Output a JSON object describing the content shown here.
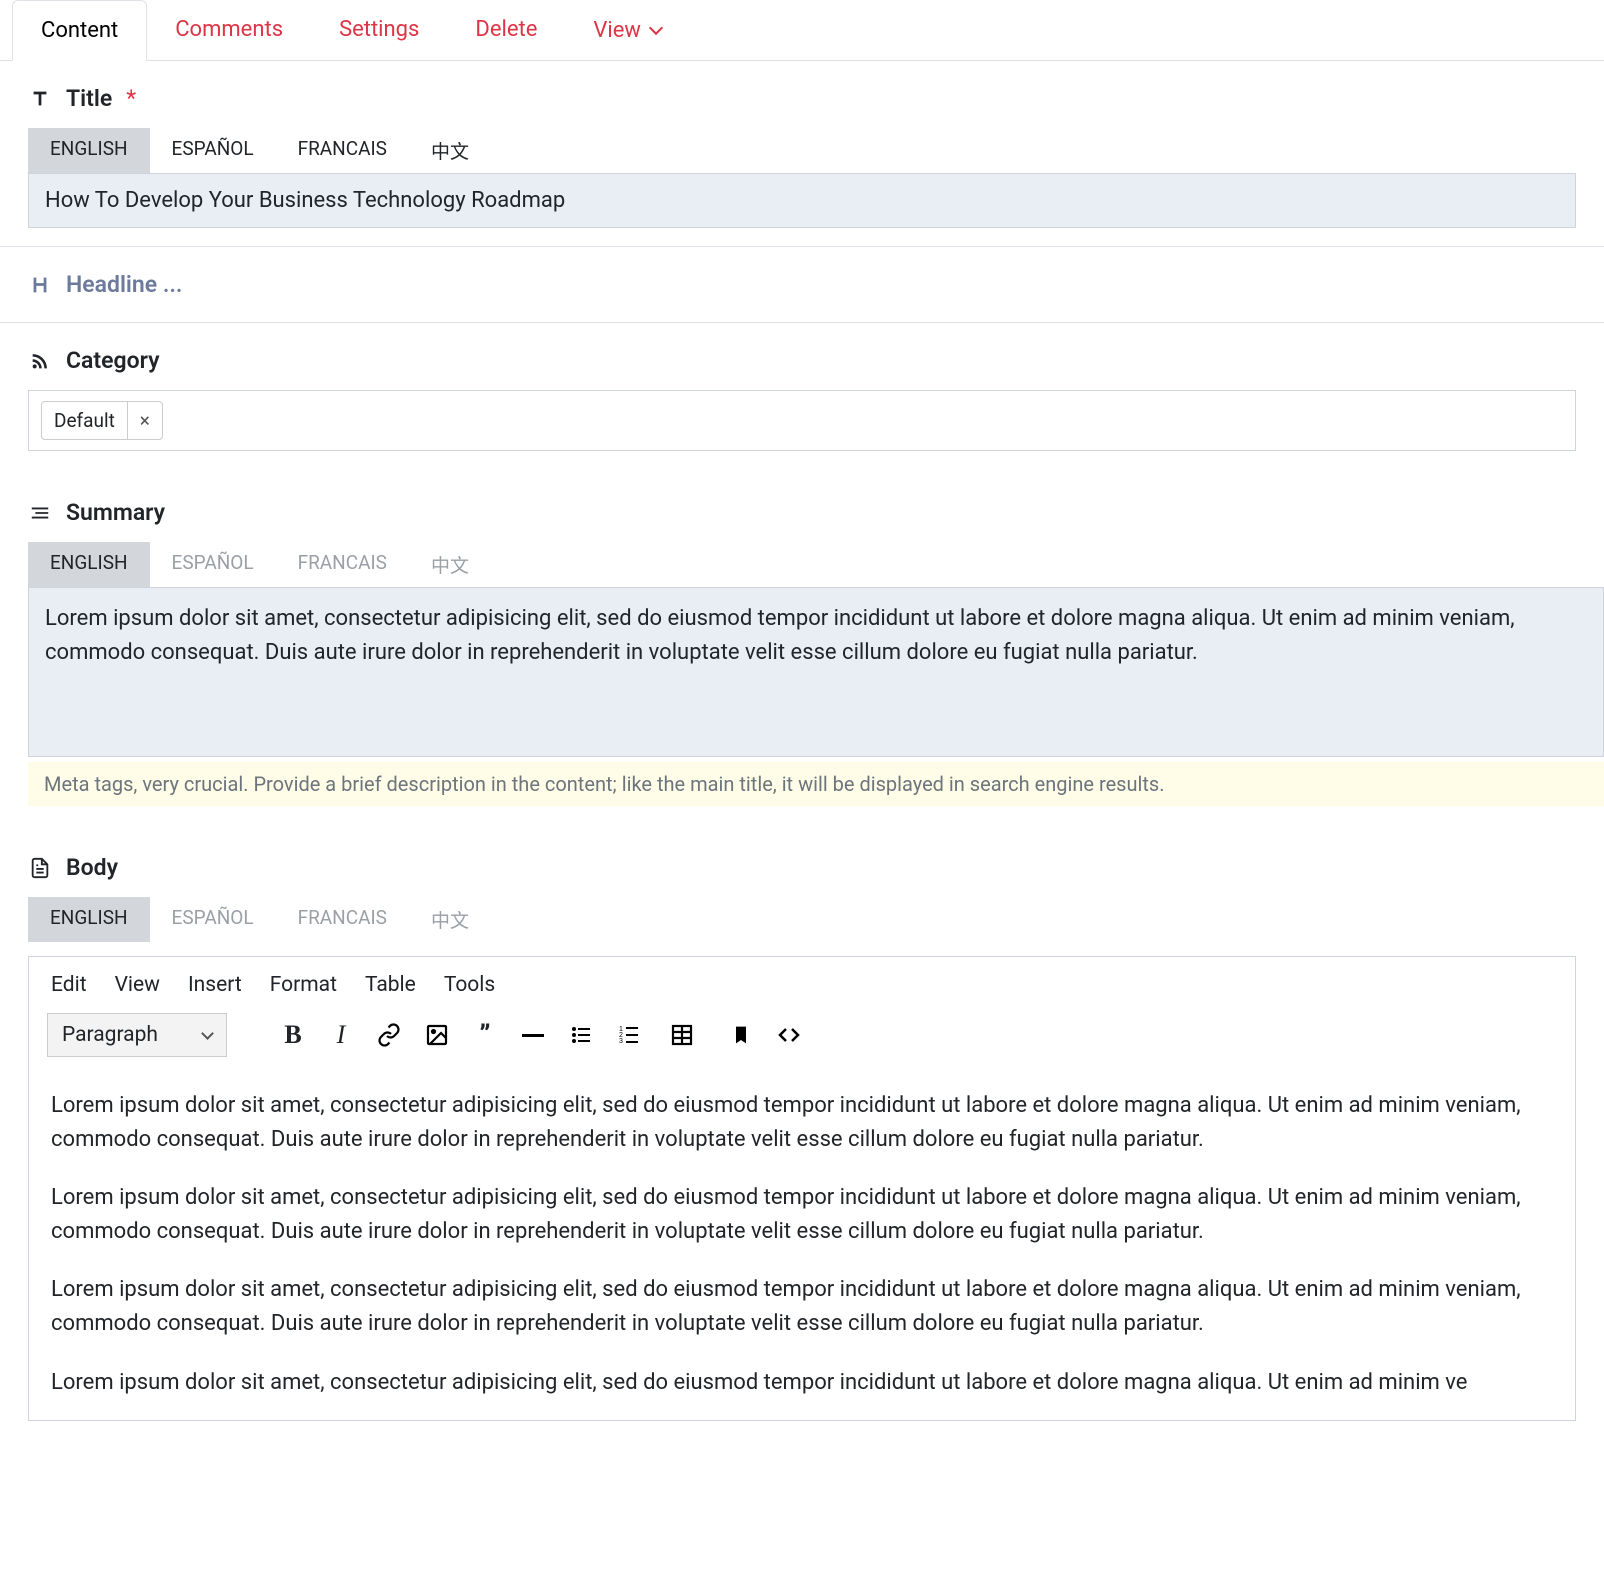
{
  "tabs": {
    "content": "Content",
    "comments": "Comments",
    "settings": "Settings",
    "delete": "Delete",
    "view": "View"
  },
  "title": {
    "label": "Title",
    "required": "*",
    "langs": {
      "en": "ENGLISH",
      "es": "ESPAÑOL",
      "fr": "FRANCAIS",
      "zh": "中文"
    },
    "value": "How To Develop Your Business Technology Roadmap"
  },
  "headline": {
    "label": "Headline ..."
  },
  "category": {
    "label": "Category",
    "tag": "Default"
  },
  "summary": {
    "label": "Summary",
    "langs": {
      "en": "ENGLISH",
      "es": "ESPAÑOL",
      "fr": "FRANCAIS",
      "zh": "中文"
    },
    "value": "Lorem ipsum dolor sit amet, consectetur adipisicing elit, sed do eiusmod tempor incididunt ut labore et dolore magna aliqua. Ut enim ad minim veniam, commodo consequat. Duis aute irure dolor in reprehenderit in voluptate velit esse cillum dolore eu fugiat nulla pariatur.",
    "hint": "Meta tags, very crucial. Provide a brief description in the content; like the main title, it will be displayed in search engine results."
  },
  "body": {
    "label": "Body",
    "langs": {
      "en": "ENGLISH",
      "es": "ESPAÑOL",
      "fr": "FRANCAIS",
      "zh": "中文"
    },
    "menu": {
      "edit": "Edit",
      "view": "View",
      "insert": "Insert",
      "format": "Format",
      "table": "Table",
      "tools": "Tools"
    },
    "format_select": "Paragraph",
    "p1": "Lorem ipsum dolor sit amet, consectetur adipisicing elit, sed do eiusmod tempor incididunt ut labore et dolore magna aliqua. Ut enim ad minim veniam, commodo consequat. Duis aute irure dolor in reprehenderit in voluptate velit esse cillum dolore eu fugiat nulla pariatur.",
    "p2": "Lorem ipsum dolor sit amet, consectetur adipisicing elit, sed do eiusmod tempor incididunt ut labore et dolore magna aliqua. Ut enim ad minim veniam, commodo consequat. Duis aute irure dolor in reprehenderit in voluptate velit esse cillum dolore eu fugiat nulla pariatur.",
    "p3": "Lorem ipsum dolor sit amet, consectetur adipisicing elit, sed do eiusmod tempor incididunt ut labore et dolore magna aliqua. Ut enim ad minim veniam, commodo consequat. Duis aute irure dolor in reprehenderit in voluptate velit esse cillum dolore eu fugiat nulla pariatur.",
    "p4": "Lorem ipsum dolor sit amet, consectetur adipisicing elit, sed do eiusmod tempor incididunt ut labore et dolore magna aliqua. Ut enim ad minim ve"
  }
}
